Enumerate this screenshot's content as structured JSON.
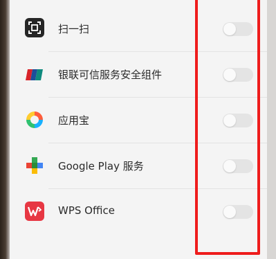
{
  "accent_colors": {
    "highlight": "#ee1c1c",
    "toggle_off": "#e4e4e4"
  },
  "apps": [
    {
      "label": "扫一扫",
      "icon": "scan-icon",
      "enabled": false
    },
    {
      "label": "银联可信服务安全组件",
      "icon": "unionpay-icon",
      "enabled": false
    },
    {
      "label": "应用宝",
      "icon": "yingyongbao-icon",
      "enabled": false
    },
    {
      "label": "Google Play 服务",
      "icon": "google-play-services-icon",
      "enabled": false
    },
    {
      "label": "WPS Office",
      "icon": "wps-office-icon",
      "enabled": false
    }
  ]
}
